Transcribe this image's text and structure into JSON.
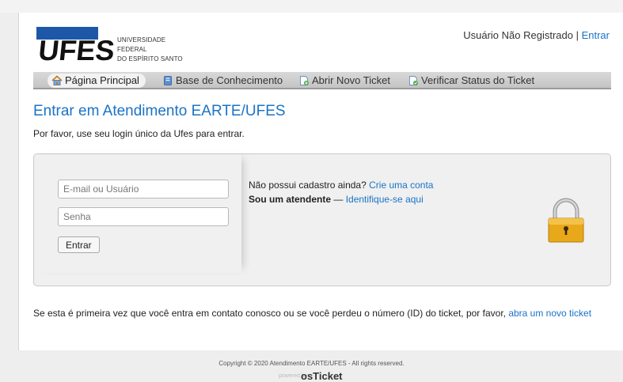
{
  "header": {
    "logo_text_line1": "Universidade Federal",
    "logo_text_line2": "do Espírito Santo",
    "user_status": "Usuário Não Registrado |",
    "login_link": "Entrar"
  },
  "nav": {
    "items": [
      {
        "label": "Página Principal",
        "icon": "home-icon"
      },
      {
        "label": "Base de Conhecimento",
        "icon": "book-icon"
      },
      {
        "label": "Abrir Novo Ticket",
        "icon": "new-ticket-icon"
      },
      {
        "label": "Verificar Status do Ticket",
        "icon": "ticket-status-icon"
      }
    ]
  },
  "main": {
    "title": "Entrar em Atendimento EARTE/UFES",
    "subtitle": "Por favor, use seu login único da Ufes para entrar."
  },
  "login": {
    "username_placeholder": "E-mail ou Usuário",
    "password_placeholder": "Senha",
    "submit_label": "Entrar",
    "no_account_text": "Não possui cadastro ainda?",
    "create_account_link": "Crie uma conta",
    "agent_text": "Sou um atendente",
    "agent_dash": " — ",
    "agent_link": "Identifique-se aqui"
  },
  "footer": {
    "note_text": "Se esta é primeira vez que você entra em contato conosco ou se você perdeu o número (ID) do ticket, por favor,",
    "note_link": "abra um novo ticket",
    "copyright": "Copyright © 2020 Atendimento EARTE/UFES - All rights reserved.",
    "powered_by": "powered by",
    "powered_brand": "osTicket"
  },
  "colors": {
    "link": "#1a73c6",
    "lock_body": "#e8a81a",
    "nav_bar": "#c9c9c9"
  }
}
